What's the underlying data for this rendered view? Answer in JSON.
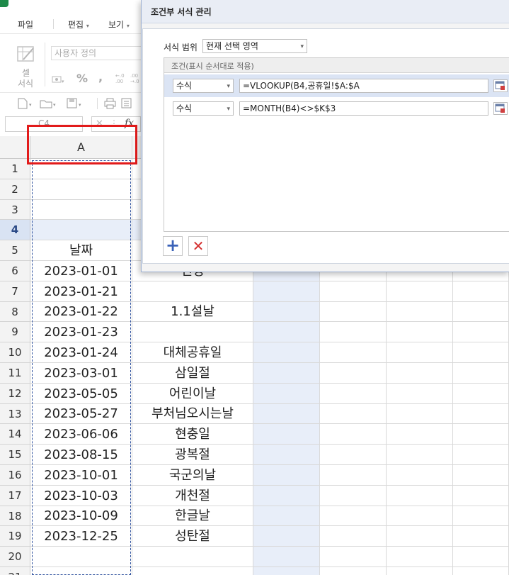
{
  "menubar": {
    "items": [
      "파일",
      "편집",
      "보기"
    ]
  },
  "ribbon": {
    "format_label": "셀\n서식",
    "format_label_line1": "셀",
    "format_label_line2": "서식",
    "number_format": "사용자 정의",
    "percent_symbol": "%",
    "comma_symbol": ","
  },
  "formula_bar": {
    "cell_ref": "C4",
    "fx_label": "fx"
  },
  "sheet": {
    "columns": [
      "A"
    ],
    "row_numbers": [
      "1",
      "2",
      "3",
      "4",
      "5",
      "6",
      "7",
      "8",
      "9",
      "10",
      "11",
      "12",
      "13",
      "14",
      "15",
      "16",
      "17",
      "18",
      "19",
      "20",
      "21"
    ],
    "selected_row": "4",
    "rows": [
      {
        "a": "",
        "b": ""
      },
      {
        "a": "",
        "b": ""
      },
      {
        "a": "",
        "b": ""
      },
      {
        "a": "",
        "b": ""
      },
      {
        "a": "날짜",
        "b": ""
      },
      {
        "a": "2023-01-01",
        "b": "신정"
      },
      {
        "a": "2023-01-21",
        "b": ""
      },
      {
        "a": "2023-01-22",
        "b": "1.1설날"
      },
      {
        "a": "2023-01-23",
        "b": ""
      },
      {
        "a": "2023-01-24",
        "b": "대체공휴일"
      },
      {
        "a": "2023-03-01",
        "b": "삼일절"
      },
      {
        "a": "2023-05-05",
        "b": "어린이날"
      },
      {
        "a": "2023-05-27",
        "b": "부처님오시는날"
      },
      {
        "a": "2023-06-06",
        "b": "현충일"
      },
      {
        "a": "2023-08-15",
        "b": "광복절"
      },
      {
        "a": "2023-10-01",
        "b": "국군의날"
      },
      {
        "a": "2023-10-03",
        "b": "개천절"
      },
      {
        "a": "2023-10-09",
        "b": "한글날"
      },
      {
        "a": "2023-12-25",
        "b": "성탄절"
      },
      {
        "a": "",
        "b": ""
      },
      {
        "a": "",
        "b": ""
      }
    ]
  },
  "dialog": {
    "title": "조건부 서식 관리",
    "scope_label": "서식 범위",
    "scope_value": "현재 선택 영역",
    "conditions_header": "조건(표시 순서대로 적용)",
    "rules": [
      {
        "type": "수식",
        "formula": "=VLOOKUP(B4,공휴일!$A:$A"
      },
      {
        "type": "수식",
        "formula": "=MONTH(B4)<>$K$3"
      }
    ],
    "add_symbol": "+",
    "delete_symbol": "✕"
  },
  "colors": {
    "selection_fill": "#e8eef9",
    "highlight_border": "#e21b1b",
    "add_button": "#3a62b8",
    "delete_button": "#d43030",
    "app_icon": "#1e8a4a"
  }
}
